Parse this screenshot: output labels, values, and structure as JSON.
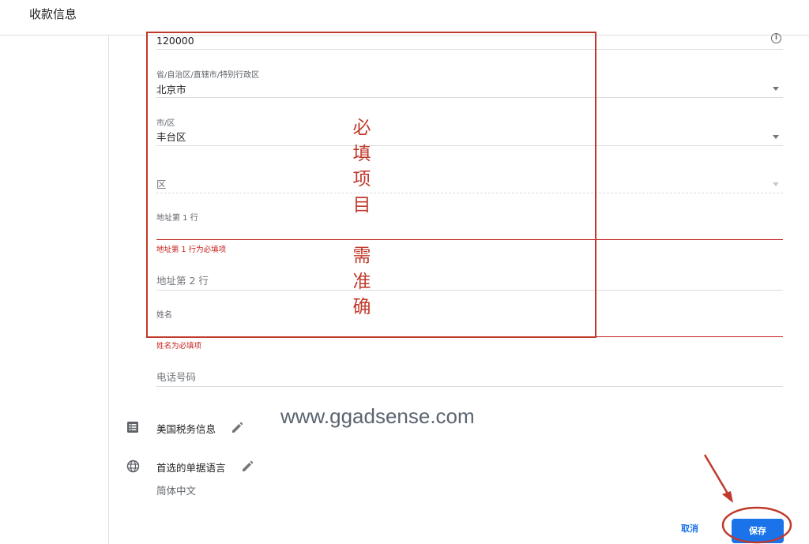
{
  "header": {
    "title": "收款信息"
  },
  "form": {
    "postal_code": {
      "value": "120000"
    },
    "province": {
      "label": "省/自治区/直辖市/特别行政区",
      "value": "北京市"
    },
    "city": {
      "label": "市/区",
      "value": "丰台区"
    },
    "district": {
      "placeholder": "区"
    },
    "address1": {
      "label": "地址第 1 行",
      "error": "地址第 1 行为必填项"
    },
    "address2": {
      "placeholder": "地址第 2 行"
    },
    "name": {
      "label": "姓名",
      "error": "姓名为必填项"
    },
    "phone": {
      "placeholder": "电话号码"
    }
  },
  "sections": {
    "tax": {
      "label": "美国税务信息"
    },
    "language": {
      "label": "首选的单据语言",
      "value": "简体中文"
    }
  },
  "actions": {
    "cancel_label": "取消",
    "save_label": "保存"
  },
  "annotations": {
    "required_note": "必填项目",
    "accurate_note": "需准确",
    "watermark": "www.ggadsense.com",
    "color": "#c0392b"
  },
  "colors": {
    "primary": "#1a73e8",
    "error": "#c5221f"
  }
}
